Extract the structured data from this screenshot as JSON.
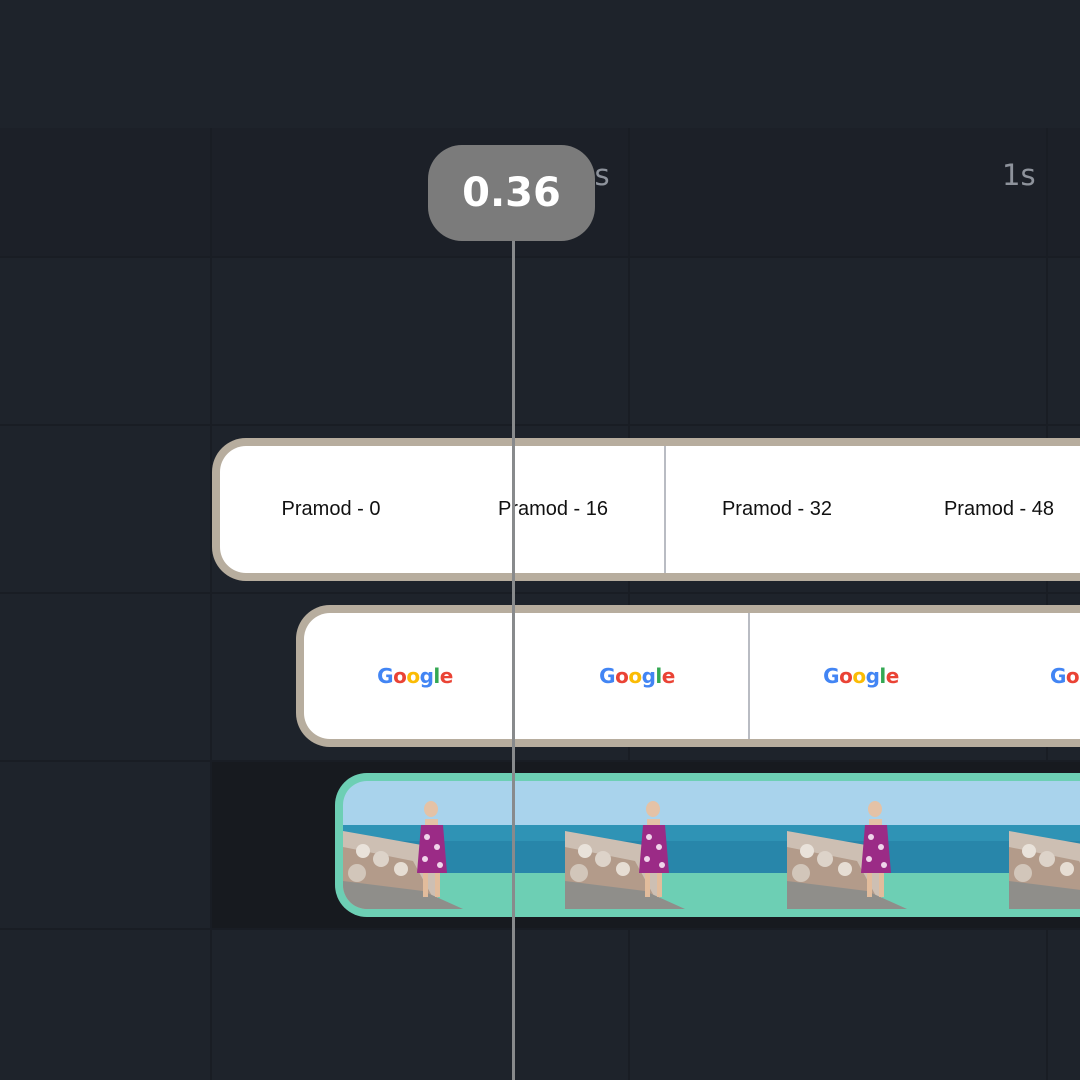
{
  "ruler": {
    "ticks": [
      {
        "label": "5s"
      },
      {
        "label": "1s"
      }
    ]
  },
  "playhead": {
    "time": "0.36"
  },
  "tracks": {
    "text_clip": {
      "frames": [
        "Pramod - 0",
        "Pramod - 16",
        "Pramod - 32",
        "Pramod - 48"
      ]
    },
    "logo_clip": {
      "frames": [
        "Google",
        "Google",
        "Google",
        "Google"
      ]
    },
    "video_clip": {
      "frame_count": 4
    }
  },
  "colors": {
    "background": "#1e232b",
    "clip_border": "#b7ad9e",
    "video_border": "#6dcfb4",
    "playhead": "#7b7b7b"
  }
}
